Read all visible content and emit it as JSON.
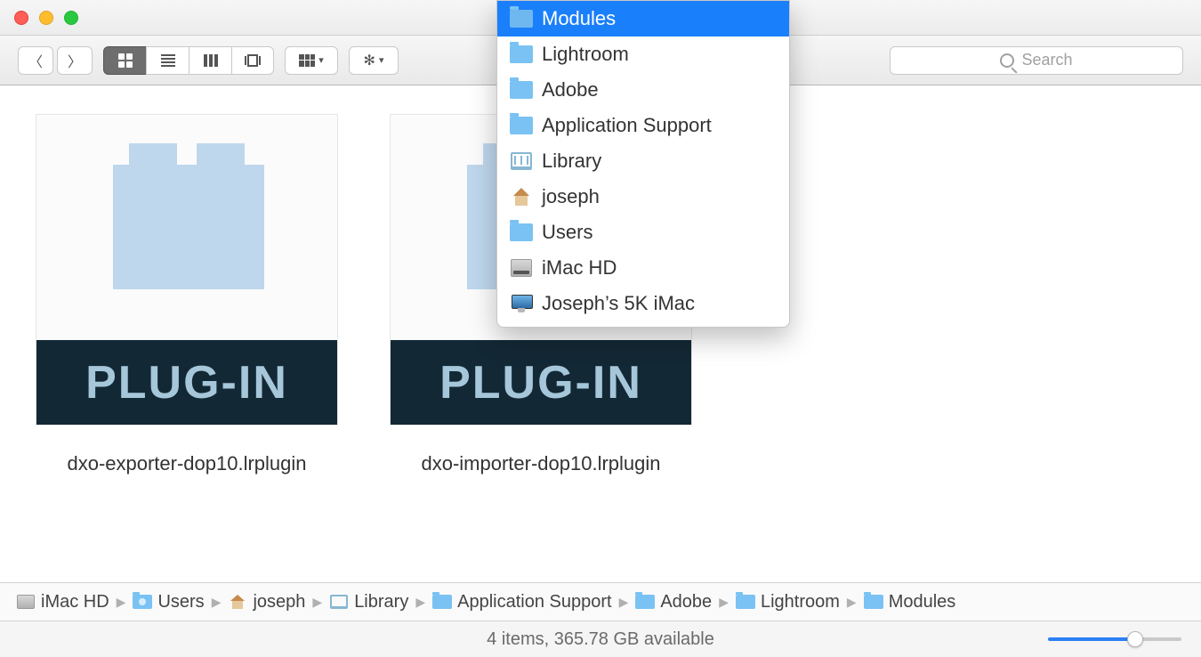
{
  "toolbar": {
    "search_placeholder": "Search"
  },
  "dropdown": {
    "items": [
      {
        "label": "Modules",
        "icon": "folder",
        "selected": true
      },
      {
        "label": "Lightroom",
        "icon": "folder"
      },
      {
        "label": "Adobe",
        "icon": "folder"
      },
      {
        "label": "Application Support",
        "icon": "folder"
      },
      {
        "label": "Library",
        "icon": "library"
      },
      {
        "label": "joseph",
        "icon": "home"
      },
      {
        "label": "Users",
        "icon": "folder"
      },
      {
        "label": "iMac HD",
        "icon": "disk"
      },
      {
        "label": "Joseph’s 5K iMac",
        "icon": "monitor"
      }
    ]
  },
  "files": [
    {
      "label": "dxo-exporter-dop10.lrplugin",
      "badge": "PLUG-IN"
    },
    {
      "label": "dxo-importer-dop10.lrplugin",
      "badge": "PLUG-IN"
    }
  ],
  "pathbar": [
    {
      "label": "iMac HD",
      "icon": "disk"
    },
    {
      "label": "Users",
      "icon": "folder-user"
    },
    {
      "label": "joseph",
      "icon": "home"
    },
    {
      "label": "Library",
      "icon": "library"
    },
    {
      "label": "Application Support",
      "icon": "folder"
    },
    {
      "label": "Adobe",
      "icon": "folder"
    },
    {
      "label": "Lightroom",
      "icon": "folder"
    },
    {
      "label": "Modules",
      "icon": "folder"
    }
  ],
  "statusbar": {
    "text": "4 items, 365.78 GB available"
  }
}
